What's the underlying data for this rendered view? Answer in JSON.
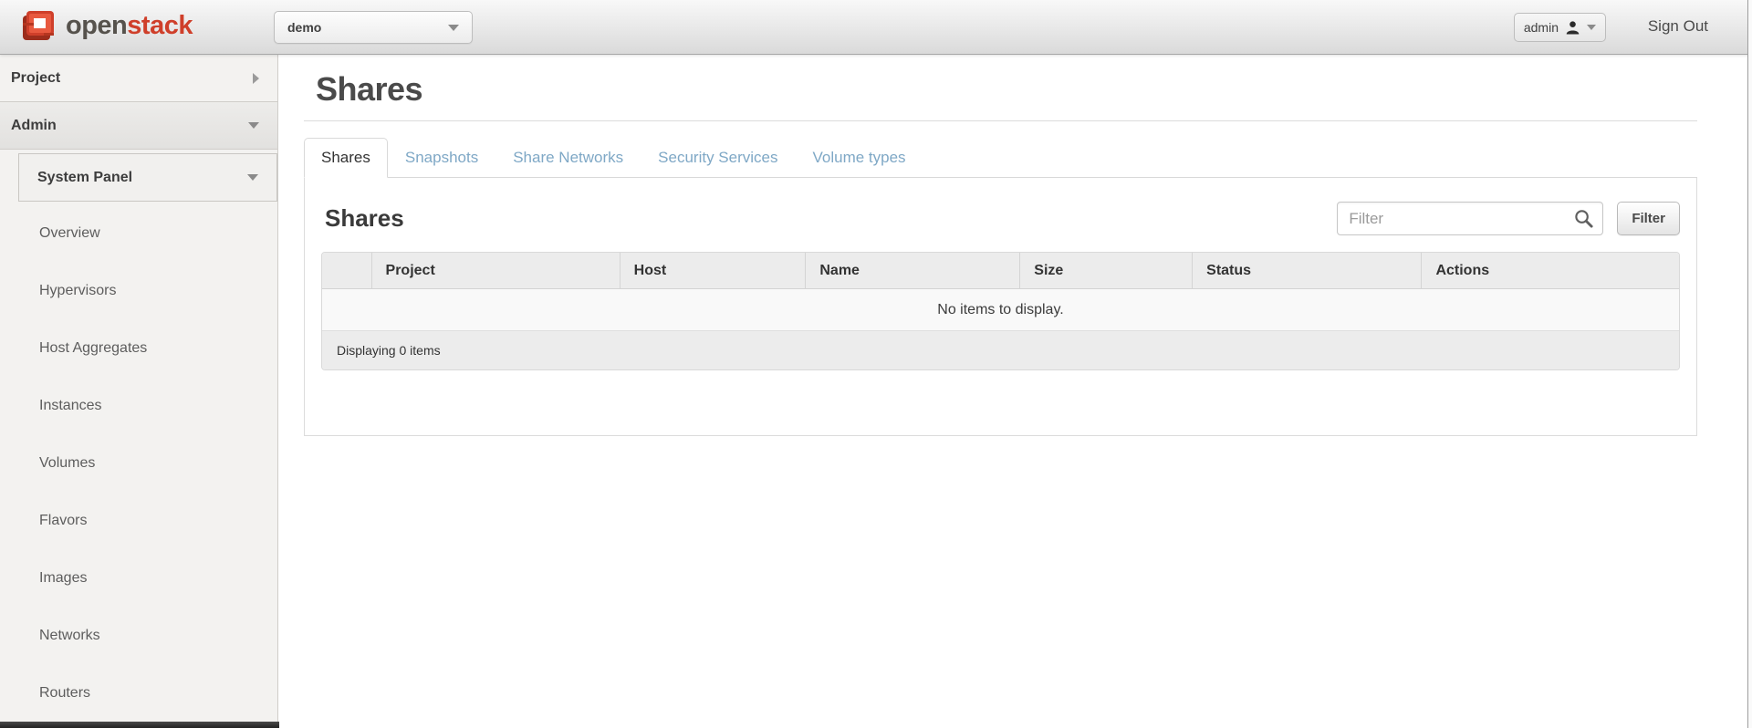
{
  "header": {
    "brand": {
      "logo_icon": "openstack-cube-icon",
      "text_open": "open",
      "text_stack": "stack"
    },
    "project_selector": {
      "value": "demo",
      "caret_icon": "chevron-down-icon"
    },
    "user_menu": {
      "label": "admin",
      "user_icon": "user-icon",
      "caret_icon": "chevron-down-icon"
    },
    "sign_out_label": "Sign Out"
  },
  "sidebar": {
    "sections": [
      {
        "label": "Project",
        "state": "collapsed",
        "caret_icon": "chevron-right-icon"
      },
      {
        "label": "Admin",
        "state": "expanded",
        "caret_icon": "chevron-down-icon"
      }
    ],
    "subpanel": {
      "label": "System Panel",
      "caret_icon": "chevron-down-icon"
    },
    "items": [
      "Overview",
      "Hypervisors",
      "Host Aggregates",
      "Instances",
      "Volumes",
      "Flavors",
      "Images",
      "Networks",
      "Routers"
    ]
  },
  "main": {
    "page_title": "Shares",
    "tabs": [
      {
        "label": "Shares",
        "active": true
      },
      {
        "label": "Snapshots",
        "active": false
      },
      {
        "label": "Share Networks",
        "active": false
      },
      {
        "label": "Security Services",
        "active": false
      },
      {
        "label": "Volume types",
        "active": false
      }
    ],
    "panel": {
      "title": "Shares",
      "filter": {
        "placeholder": "Filter",
        "search_icon": "search-icon",
        "button_label": "Filter"
      },
      "table": {
        "columns": [
          "Project",
          "Host",
          "Name",
          "Size",
          "Status",
          "Actions"
        ],
        "empty_message": "No items to display.",
        "footer": "Displaying 0 items"
      }
    }
  },
  "colors": {
    "brand_red": "#cf3f2a",
    "brand_gray": "#56524c",
    "tab_link": "#7fa8c6",
    "sidebar_bg": "#f3f2f0",
    "table_header_bg": "#ececec"
  }
}
